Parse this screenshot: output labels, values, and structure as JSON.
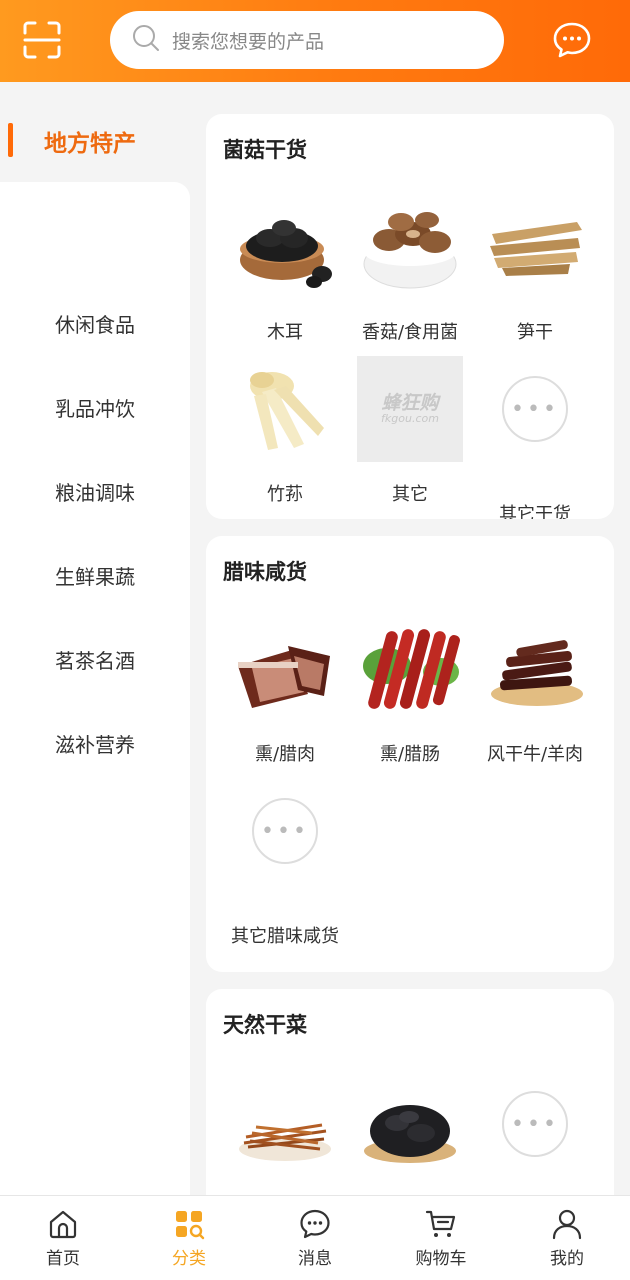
{
  "header": {
    "search_placeholder": "搜索您想要的产品",
    "scan_icon": "scan-icon",
    "message_icon": "chat-bubble-icon"
  },
  "sidebar": {
    "active": "地方特产",
    "items": [
      "休闲食品",
      "乳品冲饮",
      "粮油调味",
      "生鲜果蔬",
      "茗茶名酒",
      "滋补营养"
    ]
  },
  "sections": [
    {
      "title": "菌菇干货",
      "products": [
        {
          "name": "木耳"
        },
        {
          "name": "香菇/食用菌"
        },
        {
          "name": "笋干"
        },
        {
          "name": "竹荪"
        },
        {
          "name": "其它",
          "placeholder_logo": "蜂狂购",
          "placeholder_sub": "fkgou.com"
        },
        {
          "name": "其它干货"
        }
      ]
    },
    {
      "title": "腊味咸货",
      "products": [
        {
          "name": "熏/腊肉"
        },
        {
          "name": "熏/腊肠"
        },
        {
          "name": "风干牛/羊肉"
        },
        {
          "name": "其它腊味咸货"
        }
      ]
    },
    {
      "title": "天然干菜",
      "products": [
        {
          "name": ""
        },
        {
          "name": ""
        },
        {
          "name": ""
        }
      ]
    }
  ],
  "bottom_nav": [
    {
      "label": "首页",
      "icon": "home-icon"
    },
    {
      "label": "分类",
      "icon": "category-icon",
      "active": true
    },
    {
      "label": "消息",
      "icon": "message-icon"
    },
    {
      "label": "购物车",
      "icon": "cart-icon"
    },
    {
      "label": "我的",
      "icon": "user-icon"
    }
  ],
  "colors": {
    "accent": "#ff7a10",
    "active_text": "#ee6a10",
    "nav_active": "#f5a623"
  }
}
